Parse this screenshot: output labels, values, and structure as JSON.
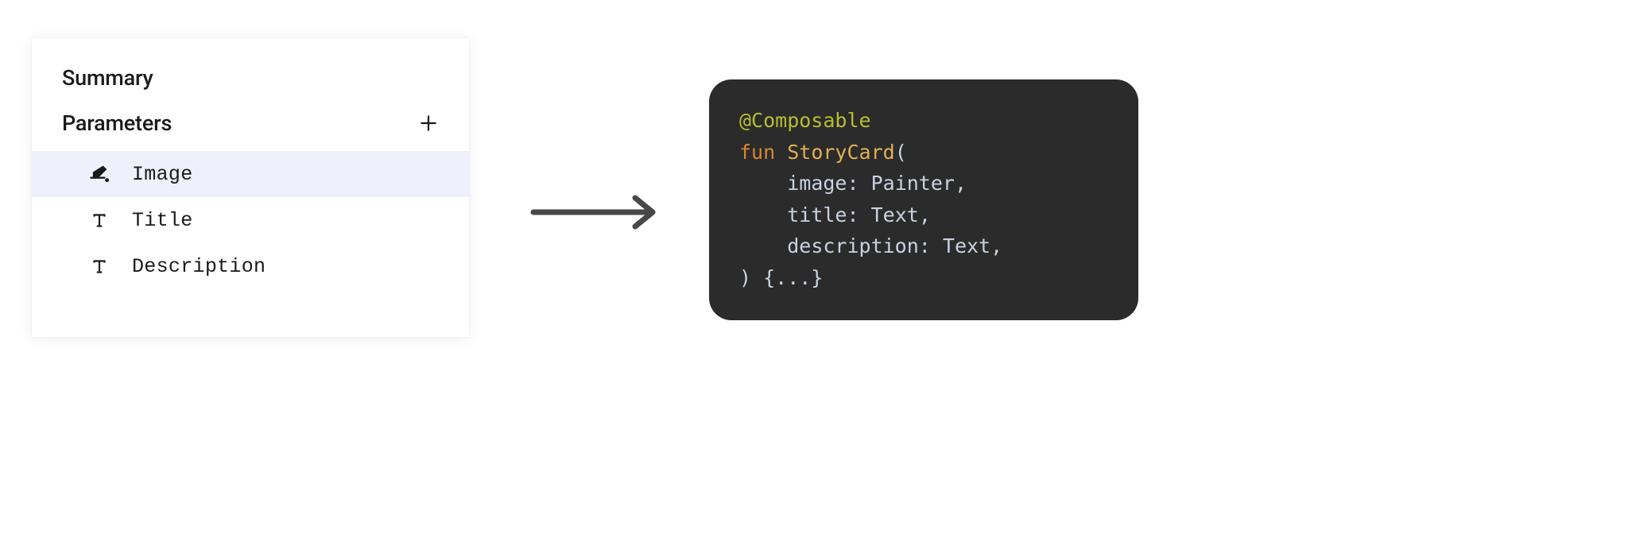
{
  "panel": {
    "summary_title": "Summary",
    "parameters_title": "Parameters",
    "params": [
      {
        "icon": "paint",
        "label": "Image",
        "selected": true
      },
      {
        "icon": "text",
        "label": "Title",
        "selected": false
      },
      {
        "icon": "text",
        "label": "Description",
        "selected": false
      }
    ]
  },
  "code": {
    "annotation": "@Composable",
    "fun_kw": "fun",
    "fn_name": "StoryCard",
    "open": "(",
    "params": [
      {
        "indent": "    ",
        "name": "image",
        "sep": ": ",
        "type": "Painter",
        "comma": ","
      },
      {
        "indent": "    ",
        "name": "title",
        "sep": ": ",
        "type": "Text",
        "comma": ","
      },
      {
        "indent": "    ",
        "name": "description",
        "sep": ": ",
        "type": "Text",
        "comma": ","
      }
    ],
    "close": ") {...}"
  }
}
